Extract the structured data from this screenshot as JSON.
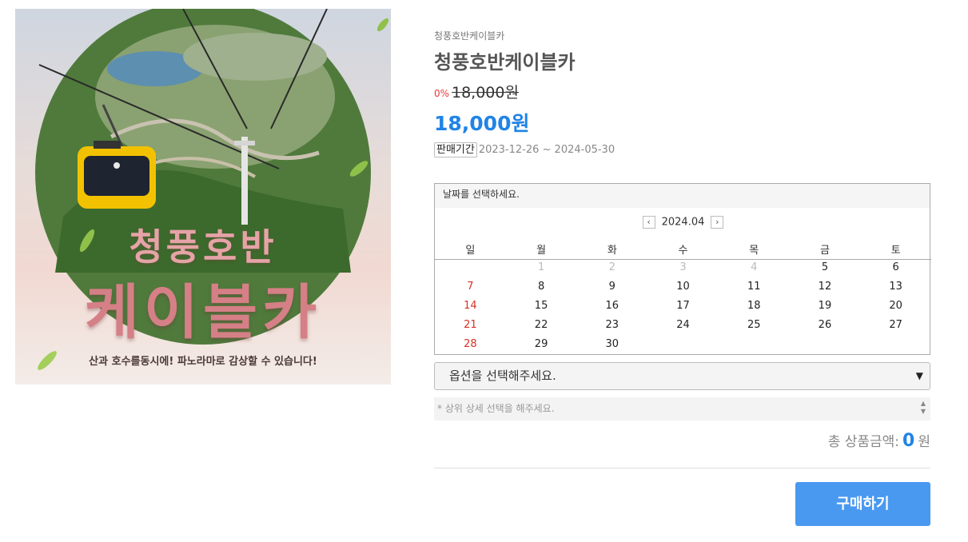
{
  "image": {
    "title_line1": "청풍호반",
    "title_line2": "케이블카",
    "caption": "산과 호수를동시에! 파노라마로 감상할 수 있습니다!"
  },
  "product": {
    "brand": "청풍호반케이블카",
    "name": "청풍호반케이블카",
    "discount": "0%",
    "original_price": "18,000원",
    "price": "18,000원",
    "period_label": "판매기간",
    "period_value": "2023-12-26 ~ 2024-05-30"
  },
  "calendar": {
    "header": "날짜를 선택하세요.",
    "month": "2024.04",
    "prev_icon": "‹",
    "next_icon": "›",
    "weekdays": [
      "일",
      "월",
      "화",
      "수",
      "목",
      "금",
      "토"
    ],
    "rows": [
      [
        "",
        "1",
        "2",
        "3",
        "4",
        "5",
        "6"
      ],
      [
        "7",
        "8",
        "9",
        "10",
        "11",
        "12",
        "13"
      ],
      [
        "14",
        "15",
        "16",
        "17",
        "18",
        "19",
        "20"
      ],
      [
        "21",
        "22",
        "23",
        "24",
        "25",
        "26",
        "27"
      ],
      [
        "28",
        "29",
        "30",
        "",
        "",
        "",
        ""
      ]
    ],
    "disabled_days": [
      "1",
      "2",
      "3",
      "4"
    ]
  },
  "option": {
    "placeholder": "옵션을 선택해주세요.",
    "hint": "* 상위 상세 선택을 해주세요."
  },
  "total": {
    "label": "총 상품금액:",
    "amount": "0",
    "unit": "원"
  },
  "buy_label": "구매하기",
  "colors": {
    "accent": "#2084e6",
    "buy_button": "#4a99f0",
    "sunday": "#d93025",
    "discount": "#e53935"
  }
}
